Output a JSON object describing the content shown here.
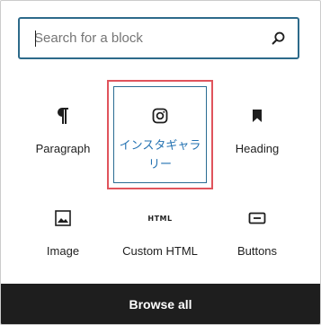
{
  "search": {
    "placeholder": "Search for a block",
    "value": ""
  },
  "blocks": [
    {
      "label": "Paragraph",
      "icon": "paragraph-icon",
      "selected": false
    },
    {
      "label": "インスタギャラリー",
      "icon": "instagram-icon",
      "selected": true
    },
    {
      "label": "Heading",
      "icon": "bookmark-icon",
      "selected": false
    },
    {
      "label": "Image",
      "icon": "image-icon",
      "selected": false
    },
    {
      "label": "Custom HTML",
      "icon": "html-icon",
      "selected": false,
      "icon_text": "HTML"
    },
    {
      "label": "Buttons",
      "icon": "button-icon",
      "selected": false
    }
  ],
  "footer": {
    "browse_label": "Browse all"
  },
  "colors": {
    "search_border": "#2d6a8a",
    "selected_outline": "#e0545c",
    "selected_text": "#2271b1",
    "footer_bg": "#1e1e1e"
  }
}
